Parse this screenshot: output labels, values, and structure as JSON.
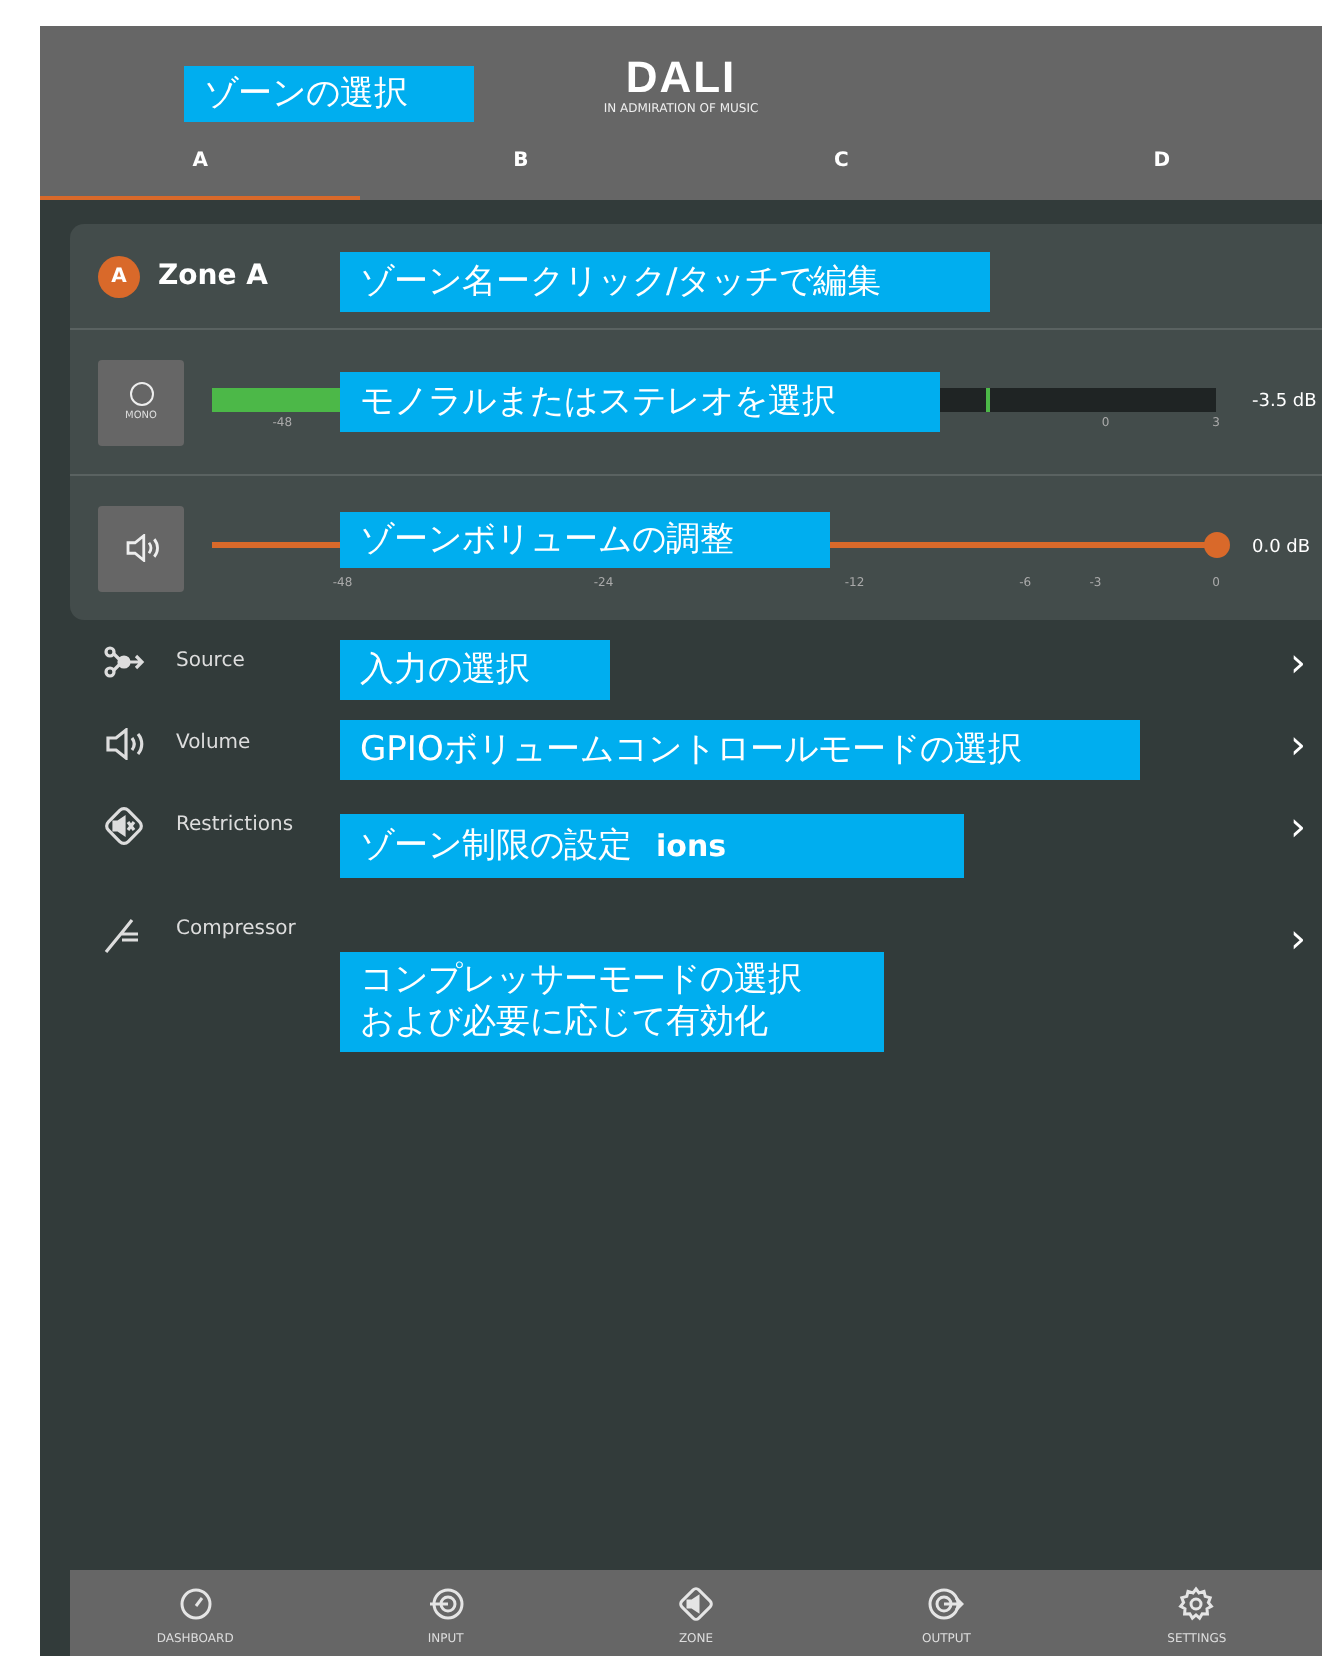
{
  "header": {
    "logo": "DALI",
    "tagline": "IN ADMIRATION OF MUSIC"
  },
  "tabs": [
    {
      "label": "A",
      "selected": true
    },
    {
      "label": "B",
      "selected": false
    },
    {
      "label": "C",
      "selected": false
    },
    {
      "label": "D",
      "selected": false
    }
  ],
  "zone": {
    "badge": "A",
    "name": "Zone A"
  },
  "meter": {
    "button_label": "MONO",
    "level": 0.35,
    "peak": {
      "level": 0.77
    },
    "reading": "-3.5 dB",
    "ticks": [
      {
        "label": "-48"
      },
      {
        "label": "0"
      },
      {
        "label": "3"
      }
    ]
  },
  "volume": {
    "level": 1,
    "reading": "0.0 dB",
    "ticks": [
      {
        "label": "-48"
      },
      {
        "label": "-24"
      },
      {
        "label": "-12"
      },
      {
        "label": "-6"
      },
      {
        "label": "-3"
      },
      {
        "label": "0"
      }
    ]
  },
  "menu": [
    {
      "kind": "source",
      "label": "Source",
      "chevron": "›"
    },
    {
      "kind": "volume",
      "label": "Volume",
      "chevron": "›"
    },
    {
      "kind": "restrictions",
      "label": "Restrictions",
      "chevron": "›"
    },
    {
      "kind": "compressor",
      "label": "Compressor",
      "chevron": "›"
    }
  ],
  "nav": [
    {
      "kind": "dashboard",
      "label": "DASHBOARD"
    },
    {
      "kind": "input",
      "label": "INPUT"
    },
    {
      "kind": "zone",
      "label": "ZONE"
    },
    {
      "kind": "output",
      "label": "OUTPUT"
    },
    {
      "kind": "settings",
      "label": "SETTINGS"
    }
  ],
  "callouts": [
    {
      "kind": "title",
      "lines": [
        "ゾーンの選択"
      ]
    },
    {
      "kind": "zone_name",
      "lines": [
        "ゾーン名ークリック/タッチで編集"
      ]
    },
    {
      "kind": "mono",
      "lines": [
        "モノラルまたはステレオを選択"
      ]
    },
    {
      "kind": "volume",
      "lines": [
        "ゾーンボリュームの調整"
      ]
    },
    {
      "kind": "source",
      "lines": [
        "入力の選択"
      ]
    },
    {
      "kind": "gpio",
      "lines": [
        "GPIOボリュームコントロールモードの選択"
      ]
    },
    {
      "kind": "restrictions",
      "lines": [
        "ゾーン制限の設定"
      ],
      "extra": "ions"
    },
    {
      "kind": "compressor",
      "lines": [
        "コンプレッサーモードの選択",
        "および必要に応じて有効化"
      ]
    }
  ]
}
